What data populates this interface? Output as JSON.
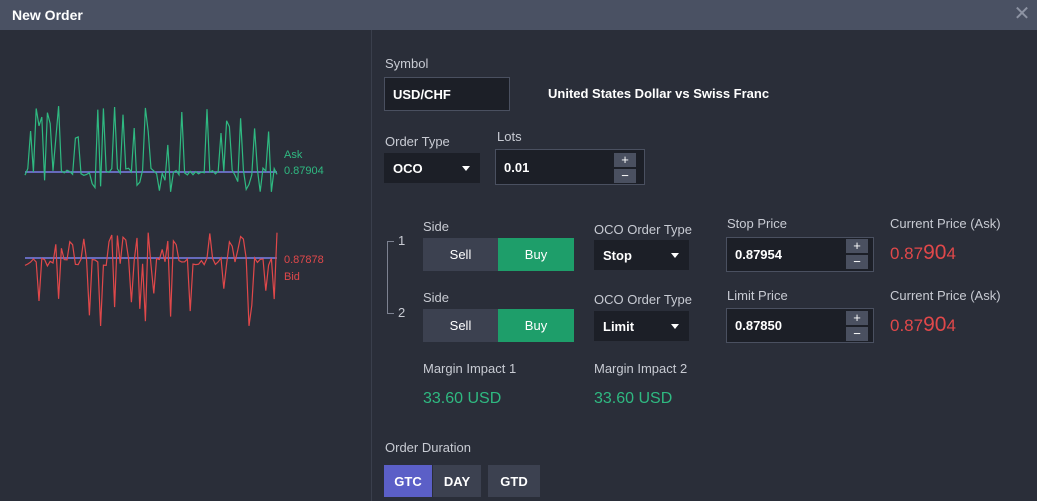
{
  "window": {
    "title": "New Order",
    "close_icon": "close-icon"
  },
  "chart": {
    "ask": {
      "label": "Ask",
      "value": "0.87904",
      "color": "#2fb981"
    },
    "bid": {
      "label": "Bid",
      "value": "0.87878",
      "color": "#e0484a"
    },
    "baseline_color": "#7b7fe8"
  },
  "symbol": {
    "label": "Symbol",
    "value": "USD/CHF",
    "description": "United States Dollar vs Swiss Franc"
  },
  "order_type": {
    "label": "Order Type",
    "value": "OCO"
  },
  "lots": {
    "label": "Lots",
    "value": "0.01"
  },
  "legs": [
    {
      "number": "1",
      "side_label": "Side",
      "sell_label": "Sell",
      "buy_label": "Buy",
      "selected_side": "Buy",
      "oco_type_label": "OCO Order Type",
      "oco_type_value": "Stop",
      "price_label": "Stop Price",
      "price_value": "0.87954",
      "current_label": "Current Price (Ask)",
      "current_prefix": "0.87",
      "current_big": "90",
      "current_suffix": "4"
    },
    {
      "number": "2",
      "side_label": "Side",
      "sell_label": "Sell",
      "buy_label": "Buy",
      "selected_side": "Buy",
      "oco_type_label": "OCO Order Type",
      "oco_type_value": "Limit",
      "price_label": "Limit Price",
      "price_value": "0.87850",
      "current_label": "Current Price (Ask)",
      "current_prefix": "0.87",
      "current_big": "90",
      "current_suffix": "4"
    }
  ],
  "stepper": {
    "plus": "+",
    "minus": "−"
  },
  "margin": [
    {
      "label": "Margin Impact 1",
      "value": "33.60 USD"
    },
    {
      "label": "Margin Impact 2",
      "value": "33.60 USD"
    }
  ],
  "duration": {
    "label": "Order Duration",
    "options": [
      "GTC",
      "DAY",
      "GTD"
    ],
    "selected": "GTC"
  }
}
